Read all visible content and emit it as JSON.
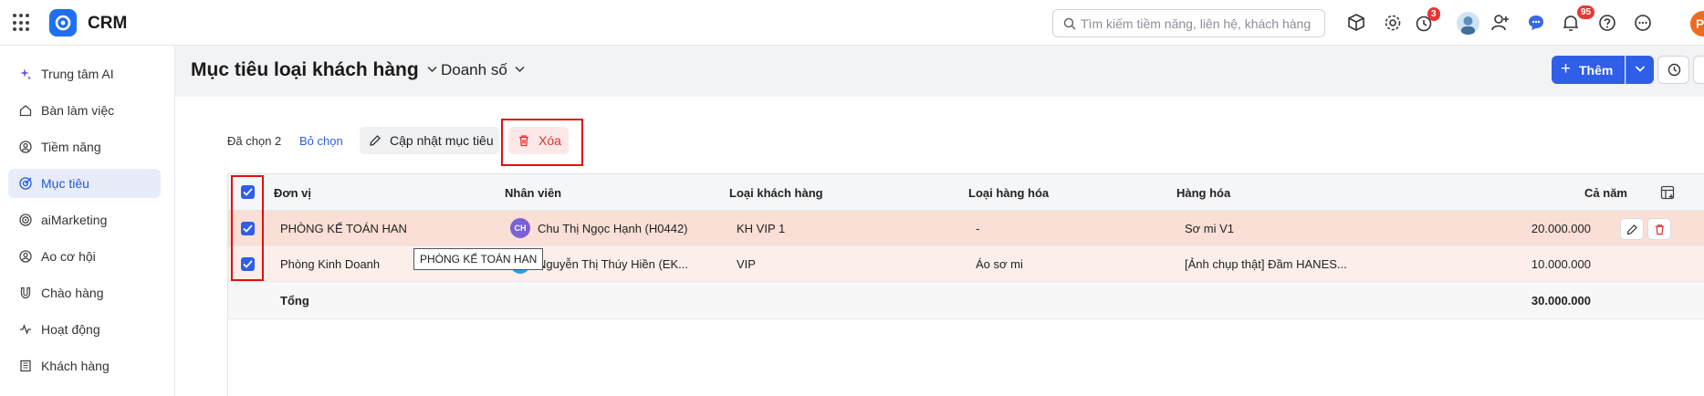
{
  "app": {
    "name": "CRM",
    "search_placeholder": "Tìm kiếm tiềm năng, liên hệ, khách hàng",
    "timer_badge": "3",
    "notification_badge": "95",
    "user_initial": "P"
  },
  "sidebar": {
    "items": [
      {
        "label": "Trung tâm AI",
        "icon": "sparkle-icon"
      },
      {
        "label": "Bàn làm việc",
        "icon": "home-icon"
      },
      {
        "label": "Tiềm năng",
        "icon": "person-circle-icon"
      },
      {
        "label": "Mục tiêu",
        "icon": "target-icon",
        "active": true
      },
      {
        "label": "aiMarketing",
        "icon": "target-rings-icon"
      },
      {
        "label": "Ao cơ hội",
        "icon": "person-circle-icon"
      },
      {
        "label": "Chào hàng",
        "icon": "magnet-icon"
      },
      {
        "label": "Hoạt động",
        "icon": "activity-icon"
      },
      {
        "label": "Khách hàng",
        "icon": "building-icon"
      }
    ]
  },
  "header": {
    "title": "Mục tiêu loại khách hàng",
    "dropdown_label": "Doanh số",
    "add_label": "Thêm"
  },
  "selection": {
    "count_label": "Đã chọn 2",
    "deselect_label": "Bỏ chọn",
    "update_label": "Cập nhật mục tiêu",
    "delete_label": "Xóa"
  },
  "table": {
    "columns": [
      "Đơn vị",
      "Nhân viên",
      "Loại khách hàng",
      "Loại hàng hóa",
      "Hàng hóa",
      "Cả năm"
    ],
    "rows": [
      {
        "unit": "PHÒNG KẾ TOÁN HAN",
        "employee_initials": "CH",
        "employee": "Chu Thị Ngọc Hạnh (H0442)",
        "customer_type": "KH VIP 1",
        "goods_type": "-",
        "goods": "Sơ mi V1",
        "year": "20.000.000"
      },
      {
        "unit": "Phòng Kinh Doanh",
        "employee_initials": "",
        "employee": "Nguyễn Thị Thúy Hiền (EK...",
        "customer_type": "VIP",
        "goods_type": "Áo sơ mi",
        "goods": "[Ảnh chụp thật] Đầm HANES...",
        "year": "10.000.000"
      }
    ],
    "total_label": "Tổng",
    "total_value": "30.000.000"
  },
  "tooltip": "PHÒNG KẾ TOÁN HAN",
  "colors": {
    "primary": "#2f5ee8",
    "danger": "#e03131",
    "highlight_outline": "#e01010",
    "row_selected": "#f9dfd6"
  }
}
